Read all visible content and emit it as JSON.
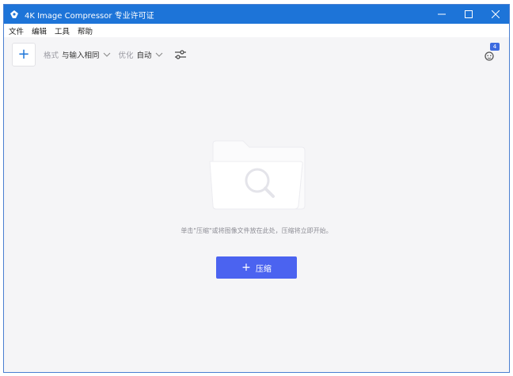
{
  "titlebar": {
    "title": "4K Image Compressor 专业许可证"
  },
  "menu": {
    "items": [
      "文件",
      "编辑",
      "工具",
      "帮助"
    ]
  },
  "toolbar": {
    "add_label": "+",
    "format_label": "格式",
    "format_value": "与输入相同",
    "optimize_label": "优化",
    "optimize_value": "自动"
  },
  "account": {
    "badge_count": "4"
  },
  "main": {
    "hint": "单击\"压缩\"或将图像文件放在此处，压缩将立即开始。",
    "compress_button": "压缩"
  },
  "colors": {
    "titlebar": "#1d74d8",
    "accent": "#4b63f0"
  }
}
